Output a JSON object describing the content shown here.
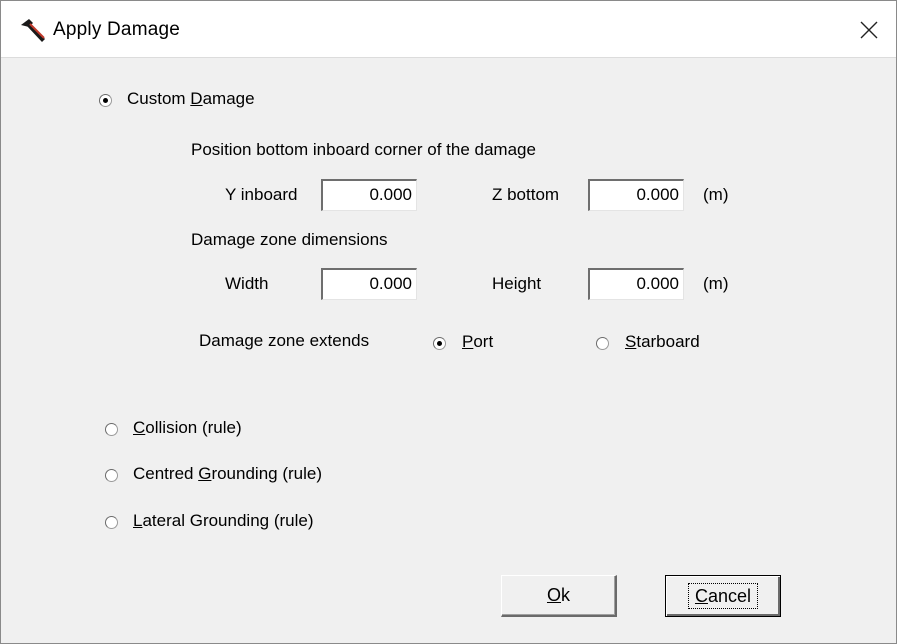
{
  "window": {
    "title": "Apply Damage",
    "close_glyph": "✕"
  },
  "custom_damage": {
    "label_before": "Custom ",
    "label_mnemonic": "D",
    "label_after": "amage",
    "checked": true
  },
  "position": {
    "heading": "Position bottom inboard corner of the damage",
    "y_inboard_label": "Y inboard",
    "y_inboard_value": "0.000",
    "z_bottom_label": "Z bottom",
    "z_bottom_value": "0.000",
    "unit": "(m)"
  },
  "dimensions": {
    "heading": "Damage zone dimensions",
    "width_label": "Width",
    "width_value": "0.000",
    "height_label": "Height",
    "height_value": "0.000",
    "unit": "(m)"
  },
  "extends": {
    "label": "Damage zone extends",
    "port_mnemonic": "P",
    "port_rest": "ort",
    "port_checked": true,
    "starboard_mnemonic": "S",
    "starboard_rest": "tarboard",
    "starboard_checked": false
  },
  "rules": {
    "collision_mnemonic": "C",
    "collision_rest": "ollision (rule)",
    "centred_before": "Centred ",
    "centred_mnemonic": "G",
    "centred_after": "rounding (rule)",
    "lateral_mnemonic": "L",
    "lateral_rest": "ateral Grounding (rule)"
  },
  "buttons": {
    "ok_mnemonic": "O",
    "ok_rest": "k",
    "cancel_mnemonic": "C",
    "cancel_rest": "ancel"
  },
  "icons": {
    "app": "hammer-icon",
    "close": "close-icon"
  }
}
